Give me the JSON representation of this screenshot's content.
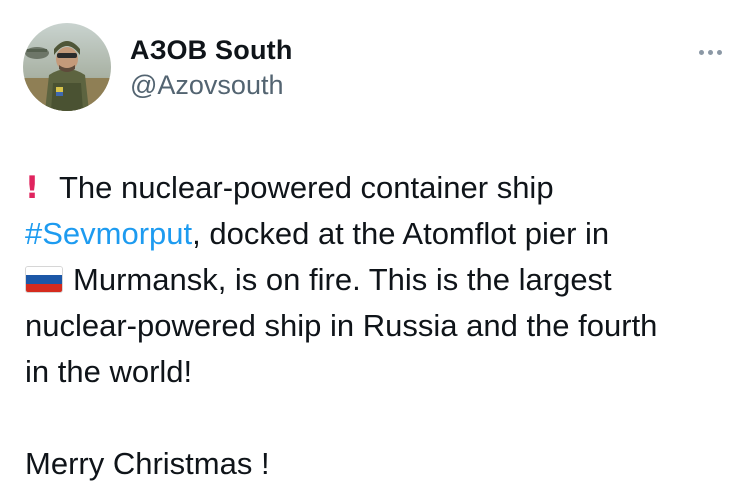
{
  "author": {
    "display_name": "АЗОВ South",
    "handle": "@Azovsouth"
  },
  "icons": {
    "more": "more-horizontal-icon",
    "alert": "exclamation-icon",
    "flag": "russia-flag-icon"
  },
  "colors": {
    "hashtag": "#1d9bf0",
    "handle": "#536471",
    "text": "#0f1419",
    "alert": "#e0245e"
  },
  "tweet": {
    "line1": "The nuclear-powered container ship",
    "hashtag": "#Sevmorput",
    "line2_rest": ", docked at the Atomflot pier in",
    "line3": "Murmansk, is on fire. This is the largest",
    "line4": "nuclear-powered ship in Russia and the fourth",
    "line5": "in the world!",
    "closing": "Merry Christmas !"
  }
}
